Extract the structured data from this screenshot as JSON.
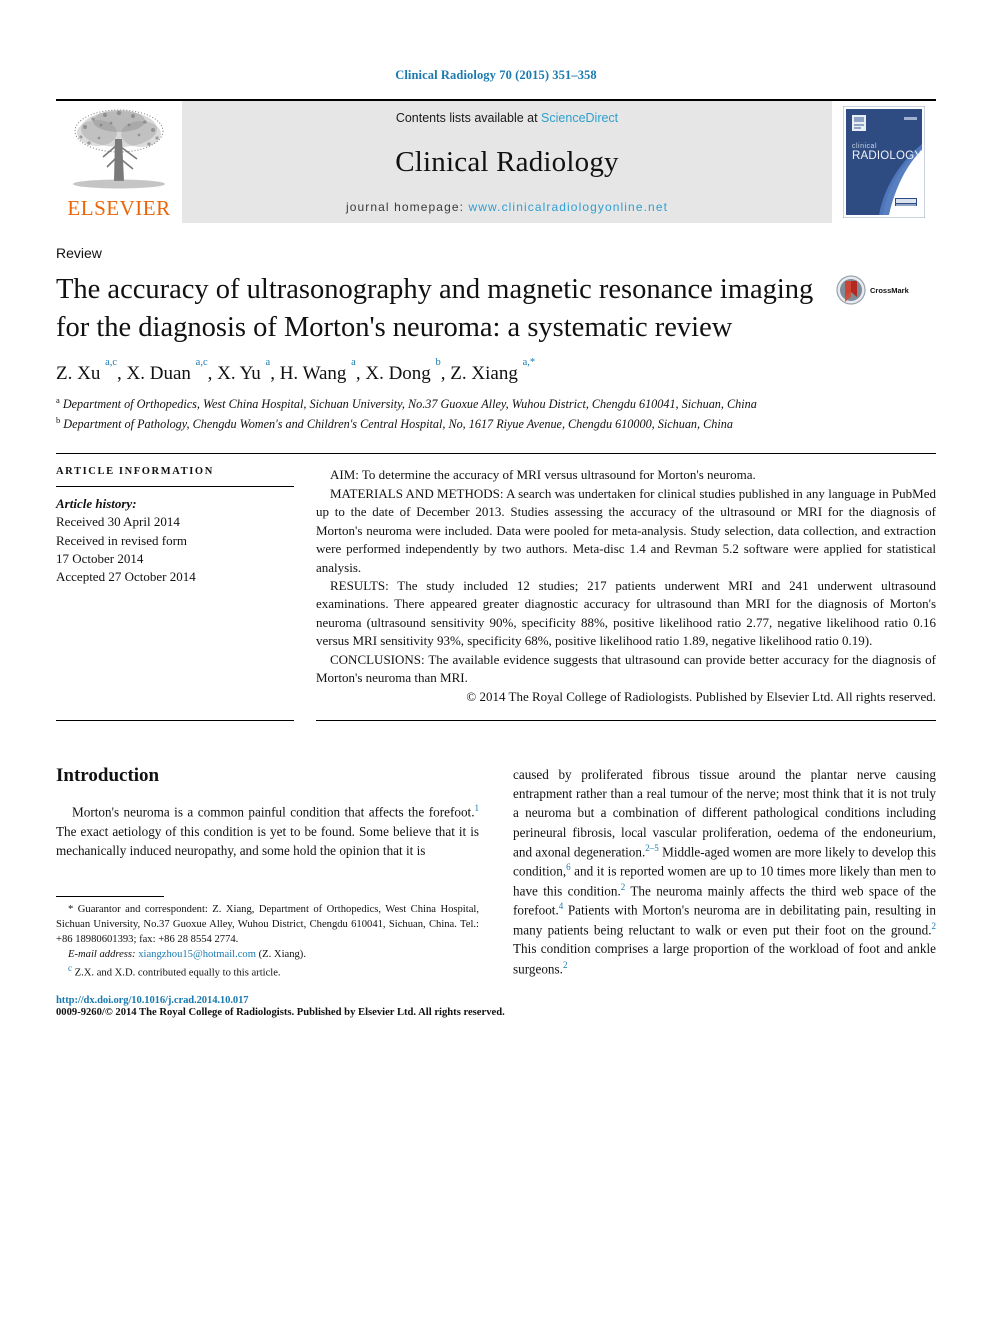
{
  "running_header": {
    "citation": "Clinical Radiology 70 (2015) 351–358",
    "citation_color": "#1a7ab0"
  },
  "masthead": {
    "publisher_name": "ELSEVIER",
    "publisher_color": "#eb6608",
    "contents_prefix": "Contents lists available at ",
    "contents_link": "ScienceDirect",
    "journal_name": "Clinical Radiology",
    "homepage_prefix": "journal homepage: ",
    "homepage_url": "www.clinicalradiologyonline.net",
    "link_color": "#2f9fd0",
    "band_color": "#e6e6e6",
    "cover": {
      "title_line1": "clinical",
      "title_line2": "RADIOLOGY",
      "bg_color": "#2e4b82",
      "publisher_badge": "ELSEVIER"
    }
  },
  "article": {
    "type": "Review",
    "title": "The accuracy of ultrasonography and magnetic resonance imaging for the diagnosis of Morton's neuroma: a systematic review",
    "crossmark_label": "CrossMark",
    "authors_html": "Z. Xu <sup>a,c</sup>, X. Duan <sup>a,c</sup>, X. Yu <sup>a</sup>, H. Wang <sup>a</sup>, X. Dong <sup>b</sup>, Z. Xiang <sup>a,*</sup>",
    "affiliation_a": "Department of Orthopedics, West China Hospital, Sichuan University, No.37 Guoxue Alley, Wuhou District, Chengdu 610041, Sichuan, China",
    "affiliation_b": "Department of Pathology, Chengdu Women's and Children's Central Hospital, No, 1617 Riyue Avenue, Chengdu 610000, Sichuan, China"
  },
  "article_information": {
    "heading": "ARTICLE INFORMATION",
    "history_label": "Article history:",
    "received": "Received 30 April 2014",
    "revised_label": "Received in revised form",
    "revised_date": "17 October 2014",
    "accepted": "Accepted 27 October 2014"
  },
  "abstract": {
    "aim": "AIM: To determine the accuracy of MRI versus ultrasound for Morton's neuroma.",
    "materials_and_methods": "MATERIALS AND METHODS: A search was undertaken for clinical studies published in any language in PubMed up to the date of December 2013. Studies assessing the accuracy of the ultrasound or MRI for the diagnosis of Morton's neuroma were included. Data were pooled for meta-analysis. Study selection, data collection, and extraction were performed independently by two authors. Meta-disc 1.4 and Revman 5.2 software were applied for statistical analysis.",
    "results": "RESULTS: The study included 12 studies; 217 patients underwent MRI and 241 underwent ultrasound examinations. There appeared greater diagnostic accuracy for ultrasound than MRI for the diagnosis of Morton's neuroma (ultrasound sensitivity 90%, specificity 88%, positive likelihood ratio 2.77, negative likelihood ratio 0.16 versus MRI sensitivity 93%, specificity 68%, positive likelihood ratio 1.89, negative likelihood ratio 0.19).",
    "conclusions": "CONCLUSIONS: The available evidence suggests that ultrasound can provide better accuracy for the diagnosis of Morton's neuroma than MRI.",
    "copyright": "© 2014 The Royal College of Radiologists. Published by Elsevier Ltd. All rights reserved."
  },
  "body": {
    "section_title": "Introduction",
    "left_paragraph_html": "Morton's neuroma is a common painful condition that affects the forefoot.<sup>1</sup> The exact aetiology of this condition is yet to be found. Some believe that it is mechanically induced neuropathy, and some hold the opinion that it is",
    "right_paragraph_html": "caused by proliferated fibrous tissue around the plantar nerve causing entrapment rather than a real tumour of the nerve; most think that it is not truly a neuroma but a combination of different pathological conditions including perineural fibrosis, local vascular proliferation, oedema of the endoneurium, and axonal degeneration.<sup>2&ndash;5</sup> Middle-aged women are more likely to develop this condition,<sup>6</sup> and it is reported women are up to 10 times more likely than men to have this condition.<sup>2</sup> The neuroma mainly affects the third web space of the forefoot.<sup>4</sup> Patients with Morton's neuroma are in debilitating pain, resulting in many patients being reluctant to walk or even put their foot on the ground.<sup>2</sup> This condition comprises a large proportion of the workload of foot and ankle surgeons.<sup>2</sup>"
  },
  "footnotes": {
    "correspondence_html": "* Guarantor and correspondent: Z. Xiang, Department of Orthopedics, West China Hospital, Sichuan University, No.37 Guoxue Alley, Wuhou District, Chengdu 610041, Sichuan, China. Tel.: +86 18980601393; fax: +86 28 8554 2774.",
    "email_label": "E-mail address:",
    "email_address": "xiangzhou15@hotmail.com",
    "email_suffix": "(Z. Xiang).",
    "equal_contribution_html": "<sup>c</sup> Z.X. and X.D. contributed equally to this article.",
    "doi": "http://dx.doi.org/10.1016/j.crad.2014.10.017",
    "issn_line": "0009-9260/© 2014 The Royal College of Radiologists. Published by Elsevier Ltd. All rights reserved."
  }
}
